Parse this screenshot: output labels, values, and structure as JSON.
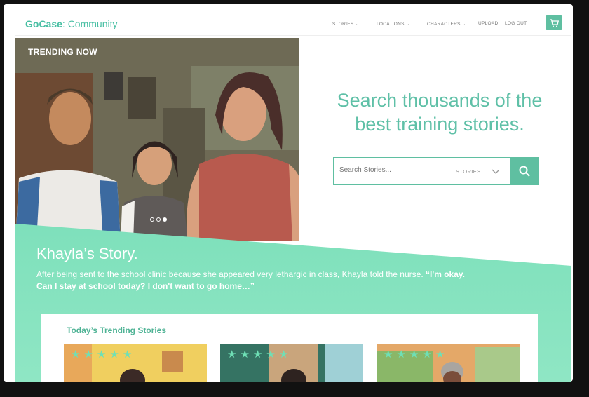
{
  "brand": {
    "bold": "GoCase",
    "rest": ": Community"
  },
  "nav": {
    "items": [
      "STORIES",
      "LOCATIONS",
      "CHARACTERS",
      "UPLOAD",
      "LOG OUT"
    ],
    "cart_icon": "cart-icon"
  },
  "hero": {
    "trending_label": "TRENDING NOW",
    "carousel_dots": 3,
    "active_dot": 3
  },
  "search": {
    "headline_line1": "Search thousands of the",
    "headline_line2": "best training stories.",
    "placeholder": "Search Stories...",
    "category": "STORIES",
    "button_icon": "search-icon"
  },
  "story": {
    "title": "Khayla’s Story.",
    "description": "After being sent to the school clinic because she appeared very lethargic in class, Khayla told the nurse. ",
    "quote": "“I'm okay. Can I stay at school today? I don't want to go home…”"
  },
  "trending": {
    "title": "Today’s Trending Stories",
    "cards": [
      {
        "stars": 5
      },
      {
        "stars": 5
      },
      {
        "stars": 5
      }
    ]
  },
  "colors": {
    "accent": "#5fbfa1",
    "banner": "#7ee0bb",
    "text_accent": "#5fc0a7"
  }
}
